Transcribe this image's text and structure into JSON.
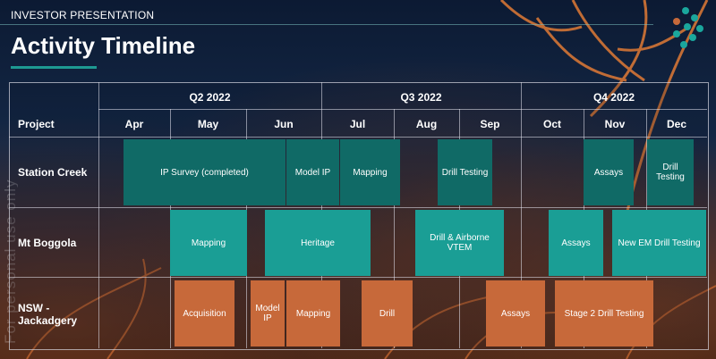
{
  "header": {
    "section": "INVESTOR PRESENTATION",
    "title": "Activity Timeline"
  },
  "watermark": "For personal use only",
  "colors": {
    "dark_teal": "#106a66",
    "teal": "#1a9e95",
    "orange": "#c7693a",
    "accent": "#1e9a92"
  },
  "logo": {
    "icon": "arrow-chevron-logo-icon"
  },
  "table": {
    "quarters": [
      "Q2 2022",
      "Q3 2022",
      "Q4 2022"
    ],
    "project_header": "Project",
    "months": [
      "Apr",
      "May",
      "Jun",
      "Jul",
      "Aug",
      "Sep",
      "Oct",
      "Nov",
      "Dec"
    ],
    "projects": [
      "Station Creek",
      "Mt Boggola",
      "NSW - Jackadgery"
    ]
  },
  "activities": {
    "station_creek": [
      "IP Survey (completed)",
      "Model IP",
      "Mapping",
      "Drill Testing",
      "Assays",
      "Drill Testing"
    ],
    "mt_boggola": [
      "Mapping",
      "Heritage",
      "Drill & Airborne VTEM",
      "Assays",
      "New EM Drill Testing"
    ],
    "nsw_jackadgery": [
      "Acquisition",
      "Model IP",
      "Mapping",
      "Drill",
      "Assays",
      "Stage 2 Drill Testing"
    ]
  }
}
